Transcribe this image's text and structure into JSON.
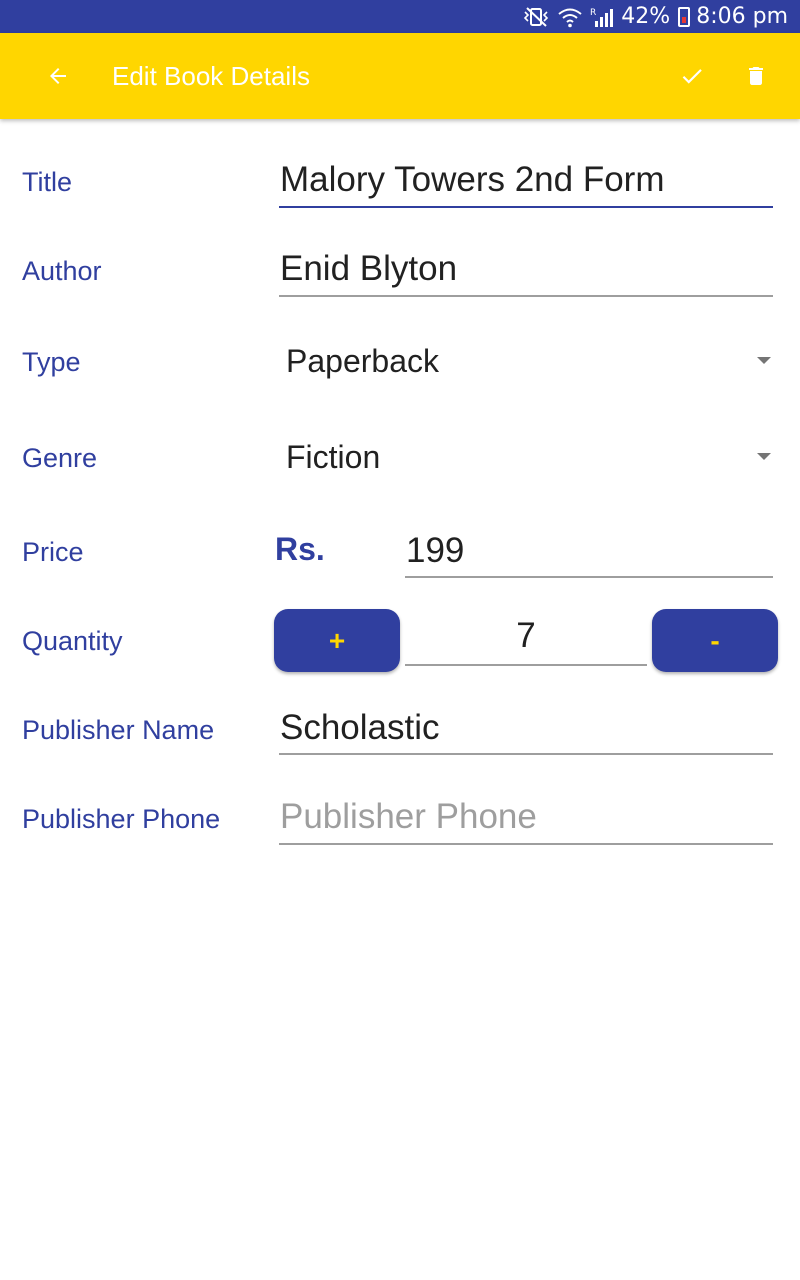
{
  "status_bar": {
    "battery": "42%",
    "time": "8:06 pm",
    "icons": [
      "vibrate-mute-icon",
      "wifi-icon",
      "roaming-signal-icon",
      "battery-icon"
    ]
  },
  "app_bar": {
    "title": "Edit Book Details",
    "background": "#ffd600",
    "icons": {
      "back": "arrow-left-icon",
      "save": "check-icon",
      "delete": "trash-icon"
    }
  },
  "form": {
    "title": {
      "label": "Title",
      "value": "Malory Towers 2nd Form"
    },
    "author": {
      "label": "Author",
      "value": "Enid Blyton"
    },
    "type": {
      "label": "Type",
      "selected": "Paperback"
    },
    "genre": {
      "label": "Genre",
      "selected": "Fiction"
    },
    "price": {
      "label": "Price",
      "currency": "Rs.",
      "value": "199"
    },
    "quantity": {
      "label": "Quantity",
      "plus": "+",
      "minus": "-",
      "value": "7"
    },
    "publisher_name": {
      "label": "Publisher Name",
      "value": "Scholastic"
    },
    "publisher_phone": {
      "label": "Publisher Phone",
      "value": "",
      "placeholder": "Publisher Phone"
    }
  },
  "colors": {
    "primary": "#303f9f",
    "accent": "#ffd600",
    "text": "#212121",
    "hint": "#9e9e9e"
  }
}
